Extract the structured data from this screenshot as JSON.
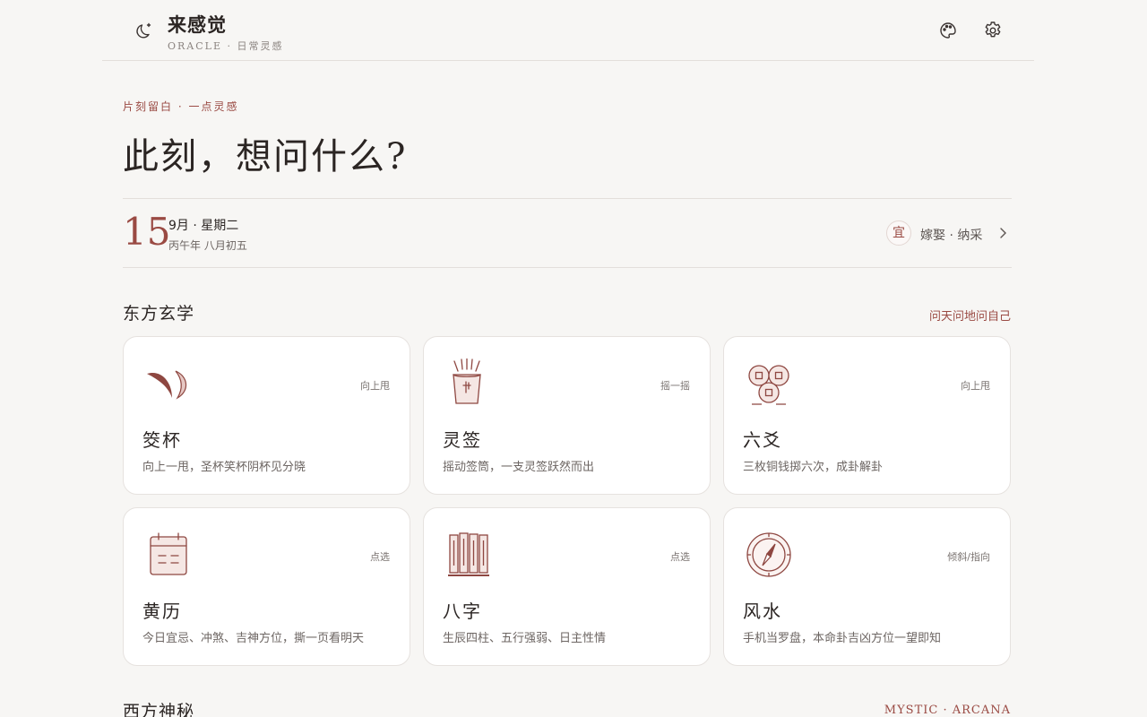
{
  "header": {
    "title": "来感觉",
    "subtitle": "ORACLE · 日常灵感"
  },
  "hero": {
    "kicker": "片刻留白 · 一点灵感",
    "headline": "此刻，想问什么?"
  },
  "date": {
    "day": "15",
    "main": "9月 · 星期二",
    "lunar": "丙午年 八月初五",
    "yi_label": "宜",
    "yi_items": "嫁娶 · 纳采"
  },
  "sections": {
    "east": {
      "title": "东方玄学",
      "link": "问天问地问自己"
    },
    "west": {
      "title": "西方神秘",
      "link": "MYSTIC · ARCANA"
    }
  },
  "cards": [
    {
      "name": "筊杯",
      "desc": "向上一甩，圣杯笑杯阴杯见分晓",
      "hint": "向上甩",
      "icon": "moon-blocks-icon"
    },
    {
      "name": "灵签",
      "desc": "摇动签筒，一支灵签跃然而出",
      "hint": "摇一摇",
      "icon": "fortune-sticks-icon"
    },
    {
      "name": "六爻",
      "desc": "三枚铜钱掷六次，成卦解卦",
      "hint": "向上甩",
      "icon": "coins-icon"
    },
    {
      "name": "黄历",
      "desc": "今日宜忌、冲煞、吉神方位，撕一页看明天",
      "hint": "点选",
      "icon": "calendar-icon"
    },
    {
      "name": "八字",
      "desc": "生辰四柱、五行强弱、日主性情",
      "hint": "点选",
      "icon": "pillars-icon"
    },
    {
      "name": "风水",
      "desc": "手机当罗盘，本命卦吉凶方位一望即知",
      "hint": "倾斜/指向",
      "icon": "compass-icon"
    }
  ],
  "colors": {
    "accent": "#9a4a43",
    "background": "#f7f6f4",
    "card": "#ffffff"
  }
}
